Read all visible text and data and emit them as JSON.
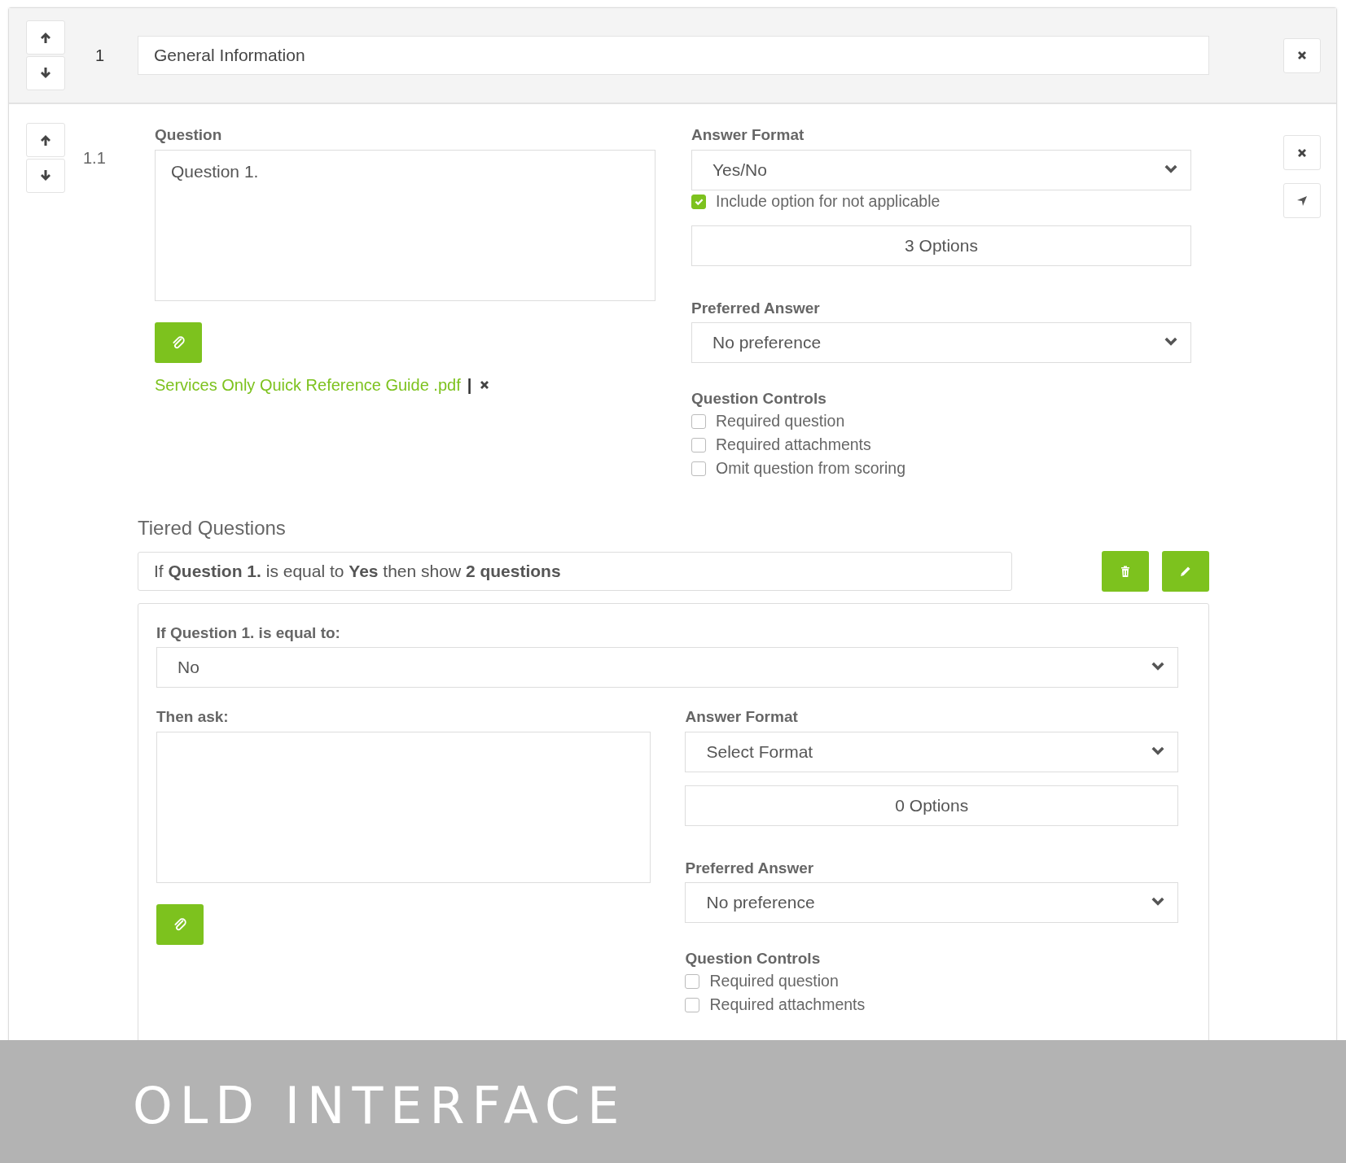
{
  "section": {
    "number": "1",
    "title": "General Information"
  },
  "question": {
    "number": "1.1",
    "label": "Question",
    "text": "Question 1.",
    "attachment": {
      "name": "Services Only Quick Reference Guide .pdf",
      "separator": "|"
    },
    "answer_format": {
      "label": "Answer Format",
      "value": "Yes/No"
    },
    "na_option": {
      "label": "Include option for not applicable",
      "checked": true
    },
    "options_button": "3 Options",
    "preferred_answer": {
      "label": "Preferred Answer",
      "value": "No preference"
    },
    "controls": {
      "label": "Question Controls",
      "items": [
        {
          "label": "Required question",
          "checked": false
        },
        {
          "label": "Required attachments",
          "checked": false
        },
        {
          "label": "Omit question from scoring",
          "checked": false
        }
      ]
    }
  },
  "tiered": {
    "heading": "Tiered Questions",
    "summary": "If **Question 1.** is equal to **Yes** then show **2 questions**",
    "condition": {
      "label": "If Question 1. is equal to:",
      "value": "No"
    },
    "then_ask": {
      "label": "Then ask:"
    },
    "answer_format": {
      "label": "Answer Format",
      "value": "Select Format"
    },
    "options_button": "0 Options",
    "preferred_answer": {
      "label": "Preferred Answer",
      "value": "No preference"
    },
    "controls": {
      "label": "Question Controls",
      "items": [
        {
          "label": "Required question",
          "checked": false
        },
        {
          "label": "Required attachments",
          "checked": false
        }
      ]
    }
  },
  "banner": "OLD INTERFACE"
}
